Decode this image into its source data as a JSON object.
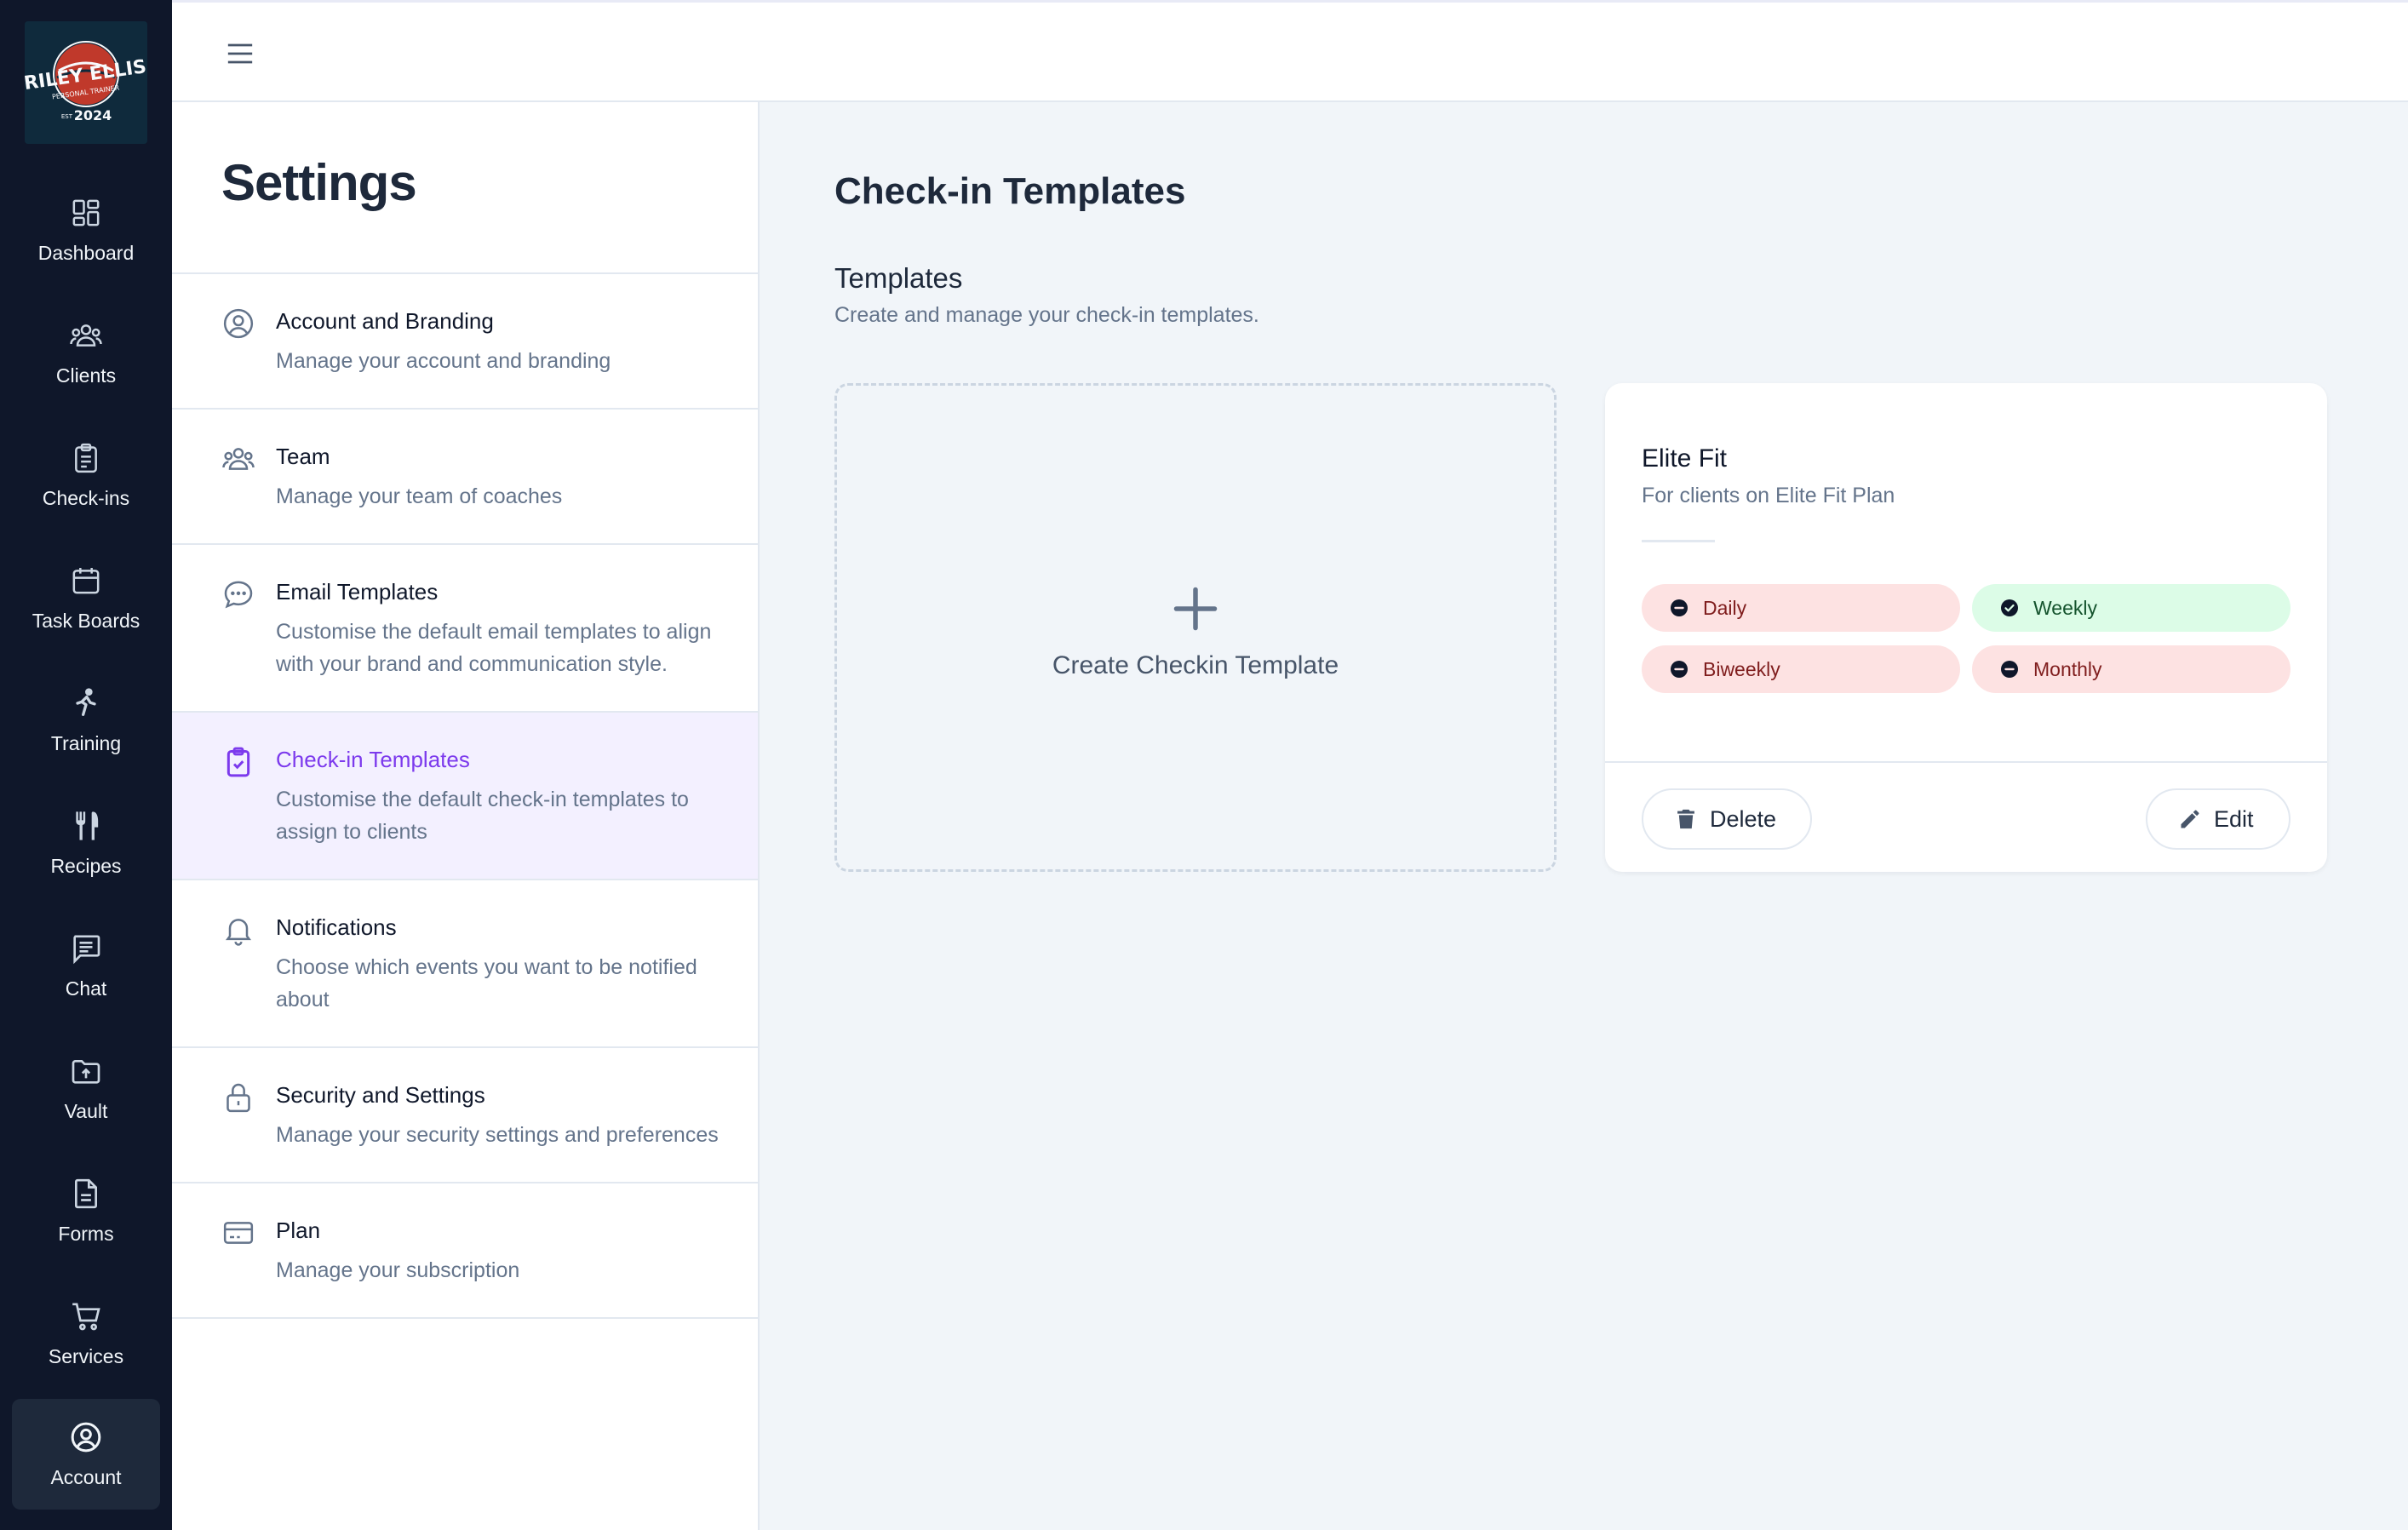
{
  "brand": {
    "logo_line1": "RILEY ELLIS",
    "logo_line2": "PERSONAL TRAINER",
    "logo_year": "2024",
    "logo_est": "EST"
  },
  "nav": [
    {
      "label": "Dashboard",
      "icon": "dashboard-icon"
    },
    {
      "label": "Clients",
      "icon": "users-icon"
    },
    {
      "label": "Check-ins",
      "icon": "clipboard-icon"
    },
    {
      "label": "Task Boards",
      "icon": "calendar-icon"
    },
    {
      "label": "Training",
      "icon": "running-icon"
    },
    {
      "label": "Recipes",
      "icon": "utensils-icon"
    },
    {
      "label": "Chat",
      "icon": "chat-icon"
    },
    {
      "label": "Vault",
      "icon": "folder-upload-icon"
    },
    {
      "label": "Forms",
      "icon": "document-icon"
    },
    {
      "label": "Services",
      "icon": "cart-icon"
    },
    {
      "label": "Account",
      "icon": "user-circle-icon",
      "active": true
    }
  ],
  "settings": {
    "title": "Settings",
    "items": [
      {
        "title": "Account and Branding",
        "desc": "Manage your account and branding",
        "icon": "user-circle-icon"
      },
      {
        "title": "Team",
        "desc": "Manage your team of coaches",
        "icon": "users-icon"
      },
      {
        "title": "Email Templates",
        "desc": "Customise the default email templates to align with your brand and communication style.",
        "icon": "chat-bubble-icon"
      },
      {
        "title": "Check-in Templates",
        "desc": "Customise the default check-in templates to assign to clients",
        "icon": "clipboard-check-icon",
        "active": true
      },
      {
        "title": "Notifications",
        "desc": "Choose which events you want to be notified about",
        "icon": "bell-icon"
      },
      {
        "title": "Security and Settings",
        "desc": "Manage your security settings and preferences",
        "icon": "lock-icon"
      },
      {
        "title": "Plan",
        "desc": "Manage your subscription",
        "icon": "credit-card-icon"
      }
    ]
  },
  "main": {
    "title": "Check-in Templates",
    "section_title": "Templates",
    "section_desc": "Create and manage your check-in templates.",
    "create_label": "Create Checkin Template",
    "template": {
      "name": "Elite Fit",
      "desc": "For clients on Elite Fit Plan",
      "frequencies": [
        {
          "label": "Daily",
          "enabled": false
        },
        {
          "label": "Weekly",
          "enabled": true
        },
        {
          "label": "Biweekly",
          "enabled": false
        },
        {
          "label": "Monthly",
          "enabled": false
        }
      ],
      "delete_label": "Delete",
      "edit_label": "Edit"
    }
  },
  "colors": {
    "nav_bg": "#0f172a",
    "accent": "#7c3aed",
    "active_bg": "#f3f0ff",
    "badge_off": "#fde2e2",
    "badge_on": "#dcfce7"
  }
}
